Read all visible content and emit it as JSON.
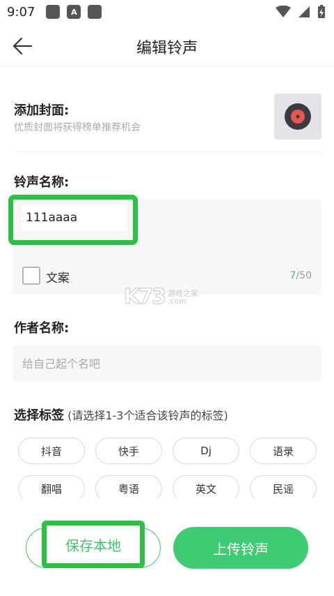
{
  "status_bar": {
    "time": "9:07",
    "notification_icons": [
      "app-icon",
      "a-icon",
      "app-icon"
    ]
  },
  "header": {
    "title": "编辑铃声",
    "back_icon": "arrow-left-icon"
  },
  "cover": {
    "title": "添加封面:",
    "hint": "优质封面将获得榜单推荐机会",
    "thumb_icon": "vinyl-record-icon"
  },
  "ringtone_name": {
    "label": "铃声名称:",
    "value": "111aaaa",
    "copy_label": "文案",
    "count_current": "7",
    "count_max": "/50"
  },
  "watermark": {
    "logo": "K73",
    "text": "游戏之家",
    "domain": ".com"
  },
  "author": {
    "label": "作者名称:",
    "placeholder": "给自己起个名吧"
  },
  "tags": {
    "title": "选择标签",
    "hint": " (请选择1-3个适合该铃声的标签)",
    "items": [
      "抖音",
      "快手",
      "Dj",
      "语录",
      "翻唱",
      "粤语",
      "英文",
      "民谣"
    ]
  },
  "actions": {
    "save_label": "保存本地",
    "upload_label": "上传铃声"
  },
  "colors": {
    "accent": "#3ecb73",
    "highlight": "#2bbf44"
  }
}
